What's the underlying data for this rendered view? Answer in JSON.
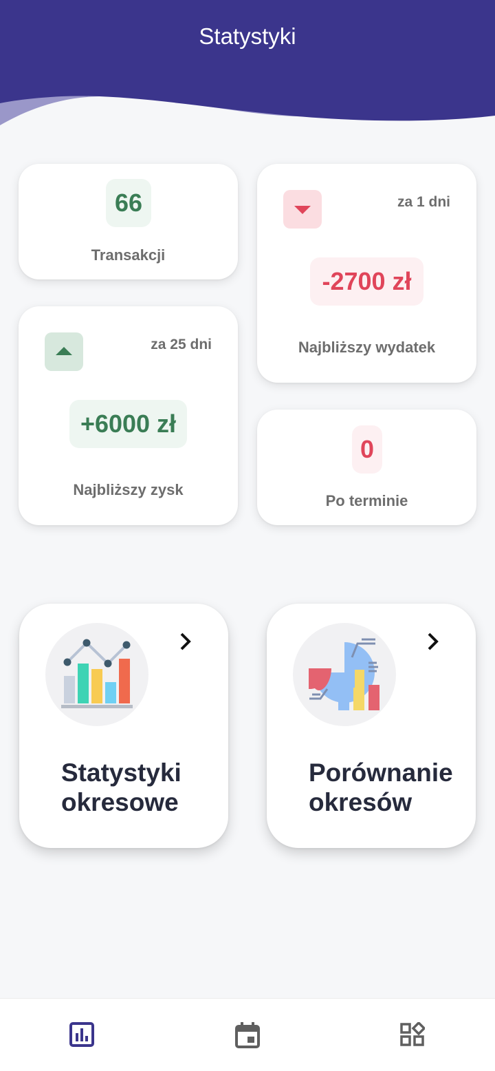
{
  "header": {
    "title": "Statystyki"
  },
  "stats": {
    "transactions": {
      "value": "66",
      "label": "Transakcji"
    },
    "next_expense": {
      "days": "za 1 dni",
      "value": "-2700 zł",
      "label": "Najbliższy wydatek"
    },
    "next_income": {
      "days": "za 25 dni",
      "value": "+6000 zł",
      "label": "Najbliższy zysk"
    },
    "overdue": {
      "value": "0",
      "label": "Po terminie"
    }
  },
  "sections": [
    {
      "title_line1": "Statystyki",
      "title_line2": "okresowe"
    },
    {
      "title_line1": "Porównanie",
      "title_line2": "okresów"
    }
  ],
  "colors": {
    "header": "#3b358c",
    "header_wave": "#9a97c9",
    "positive": "#3a7d55",
    "negative": "#e0455a",
    "nav_active": "#3b358c",
    "nav_inactive": "#5f5f5f"
  },
  "nav": {
    "items": [
      {
        "icon": "bar-chart-icon",
        "active": true
      },
      {
        "icon": "calendar-icon",
        "active": false
      },
      {
        "icon": "apps-icon",
        "active": false
      }
    ]
  }
}
